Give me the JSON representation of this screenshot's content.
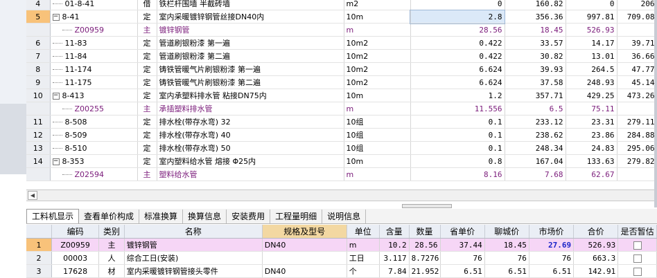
{
  "upper_rows": [
    {
      "rn": "4",
      "code": "01-8-41",
      "type": "借",
      "name": "铁栏杆围墙 半截砖墙",
      "unit": "m2",
      "qty": "0",
      "p1": "160.82",
      "p2": "0",
      "p3": "206",
      "tree": "line"
    },
    {
      "rn": "5",
      "code": "8-41",
      "type": "定",
      "name": "室内采暖镀锌钢管丝接DN40内",
      "unit": "10m",
      "qty": "2.8",
      "p1": "356.36",
      "p2": "997.81",
      "p3": "709.08",
      "tree": "minus",
      "selected": true
    },
    {
      "rn": "",
      "code": "Z00959",
      "type": "主",
      "name": "镀锌钢管",
      "unit": "m",
      "qty": "28.56",
      "p1": "18.45",
      "p2": "526.93",
      "p3": "",
      "material": true
    },
    {
      "rn": "6",
      "code": "11-83",
      "type": "定",
      "name": "管道刷银粉漆 第一遍",
      "unit": "10m2",
      "qty": "0.422",
      "p1": "33.57",
      "p2": "14.17",
      "p3": "39.71",
      "tree": "line"
    },
    {
      "rn": "7",
      "code": "11-84",
      "type": "定",
      "name": "管道刷银粉漆 第二遍",
      "unit": "10m2",
      "qty": "0.422",
      "p1": "30.82",
      "p2": "13.01",
      "p3": "36.66",
      "tree": "line"
    },
    {
      "rn": "8",
      "code": "11-174",
      "type": "定",
      "name": "铸铁管暖气片刷银粉漆 第一遍",
      "unit": "10m2",
      "qty": "6.624",
      "p1": "39.93",
      "p2": "264.5",
      "p3": "47.77",
      "tree": "line"
    },
    {
      "rn": "9",
      "code": "11-175",
      "type": "定",
      "name": "铸铁管暖气片刷银粉漆 第二遍",
      "unit": "10m2",
      "qty": "6.624",
      "p1": "37.58",
      "p2": "248.93",
      "p3": "45.14",
      "tree": "line"
    },
    {
      "rn": "10",
      "code": "8-413",
      "type": "定",
      "name": "室内承塑料排水管 粘接DN75内",
      "unit": "10m",
      "qty": "1.2",
      "p1": "357.71",
      "p2": "429.25",
      "p3": "473.26",
      "tree": "minus"
    },
    {
      "rn": "",
      "code": "Z00255",
      "type": "主",
      "name": "承插塑料排水管",
      "unit": "m",
      "qty": "11.556",
      "p1": "6.5",
      "p2": "75.11",
      "p3": "",
      "material": true
    },
    {
      "rn": "11",
      "code": "8-508",
      "type": "定",
      "name": "排水栓(带存水弯) 32",
      "unit": "10组",
      "qty": "0.1",
      "p1": "233.12",
      "p2": "23.31",
      "p3": "279.11",
      "tree": "line"
    },
    {
      "rn": "12",
      "code": "8-509",
      "type": "定",
      "name": "排水栓(带存水弯) 40",
      "unit": "10组",
      "qty": "0.1",
      "p1": "238.62",
      "p2": "23.86",
      "p3": "284.88",
      "tree": "line"
    },
    {
      "rn": "13",
      "code": "8-510",
      "type": "定",
      "name": "排水栓(带存水弯) 50",
      "unit": "10组",
      "qty": "0.1",
      "p1": "248.34",
      "p2": "24.83",
      "p3": "295.06",
      "tree": "line"
    },
    {
      "rn": "14",
      "code": "8-353",
      "type": "定",
      "name": "室内塑料给水管 熔接 Φ25内",
      "unit": "10m",
      "qty": "0.8",
      "p1": "167.04",
      "p2": "133.63",
      "p3": "279.82",
      "tree": "minus"
    },
    {
      "rn": "",
      "code": "Z02594",
      "type": "主",
      "name": "塑料给水管",
      "unit": "m",
      "qty": "8.16",
      "p1": "7.68",
      "p2": "62.67",
      "p3": "",
      "material": true
    }
  ],
  "tabs": [
    "工料机显示",
    "查看单价构成",
    "标准换算",
    "换算信息",
    "安装费用",
    "工程量明细",
    "说明信息"
  ],
  "lower_headers": [
    "编码",
    "类别",
    "名称",
    "规格及型号",
    "单位",
    "含量",
    "数量",
    "省单价",
    "聊城价",
    "市场价",
    "合价",
    "是否暂估"
  ],
  "lower_rows": [
    {
      "rn": "1",
      "code": "Z00959",
      "cat": "主",
      "name": "镀锌钢管",
      "spec": "DN40",
      "unit": "m",
      "content": "10.2",
      "qty": "28.56",
      "prov": "37.44",
      "city": "18.45",
      "market": "27.69",
      "total": "526.93",
      "selected": true
    },
    {
      "rn": "2",
      "code": "00003",
      "cat": "人",
      "name": "综合工日(安装)",
      "spec": "",
      "unit": "工日",
      "content": "3.117",
      "qty": "8.7276",
      "prov": "76",
      "city": "76",
      "market": "76",
      "total": "663.3"
    },
    {
      "rn": "3",
      "code": "17628",
      "cat": "材",
      "name": "室内采暖镀锌钢管接头零件",
      "spec": "DN40",
      "unit": "个",
      "content": "7.84",
      "qty": "21.952",
      "prov": "6.51",
      "city": "6.51",
      "market": "6.51",
      "total": "142.91"
    }
  ]
}
